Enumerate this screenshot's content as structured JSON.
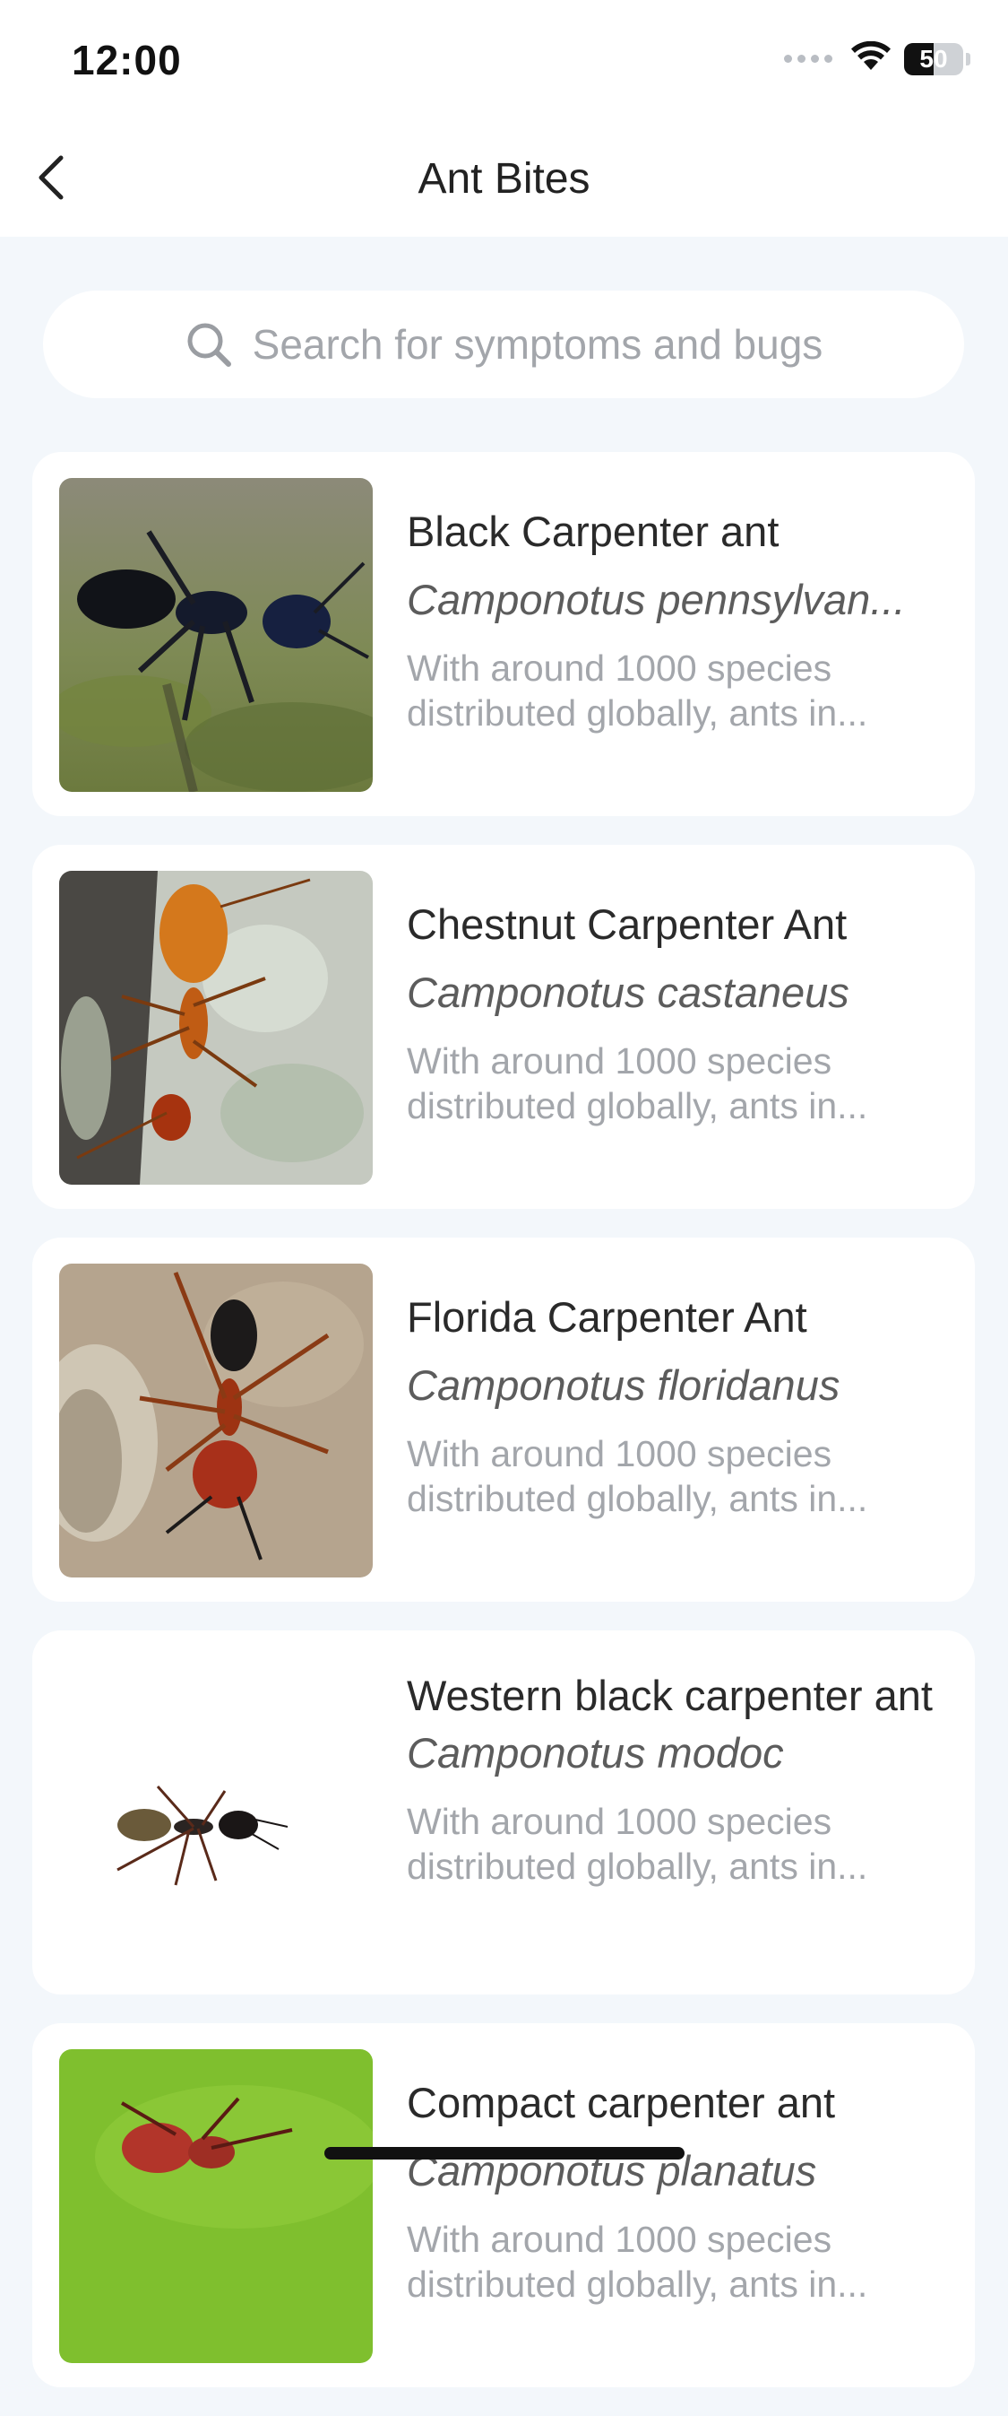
{
  "status_bar": {
    "time": "12:00",
    "battery": "50",
    "battery_level": 0.5
  },
  "nav": {
    "title": "Ant Bites",
    "back_icon": "chevron-left-icon"
  },
  "search": {
    "placeholder": "Search for symptoms and bugs",
    "icon": "search-icon"
  },
  "items": [
    {
      "title": "Black Carpenter ant",
      "scientific_name": "Camponotus pennsylvan...",
      "desc_line1": "With around 1000 species",
      "desc_line2": "distributed globally, ants in..."
    },
    {
      "title": "Chestnut Carpenter Ant",
      "scientific_name": "Camponotus castaneus",
      "desc_line1": "With around 1000 species",
      "desc_line2": "distributed globally, ants in..."
    },
    {
      "title": "Florida Carpenter Ant",
      "scientific_name": "Camponotus floridanus",
      "desc_line1": "With around 1000 species",
      "desc_line2": "distributed globally, ants in..."
    },
    {
      "title": "Western black carpenter ant",
      "scientific_name": "Camponotus modoc",
      "desc_line1": "With around 1000 species",
      "desc_line2": "distributed globally, ants in..."
    },
    {
      "title": "Compact carpenter ant",
      "scientific_name": "Camponotus planatus",
      "desc_line1": "With around 1000 species",
      "desc_line2": "distributed globally, ants in..."
    }
  ],
  "colors": {
    "background": "#f3f7fb",
    "card": "#ffffff",
    "muted_text": "#a3a6ab"
  }
}
